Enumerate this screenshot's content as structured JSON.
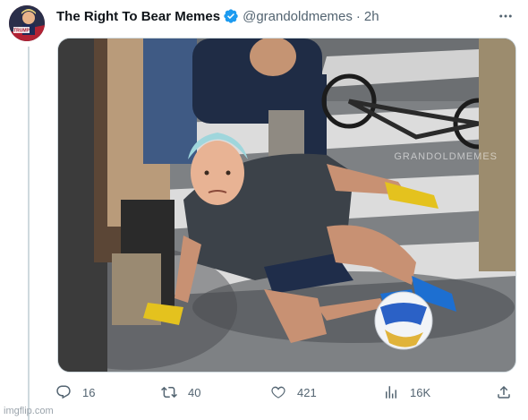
{
  "tweet": {
    "author": {
      "display_name": "The Right To Bear Memes",
      "verified": true,
      "handle": "@grandoldmemes",
      "separator": "·",
      "time": "2h",
      "avatar_text": "TRUMP"
    },
    "media": {
      "watermark": "GRANDOLDMEMES"
    },
    "actions": {
      "reply": {
        "icon": "reply-icon",
        "count": "16"
      },
      "retweet": {
        "icon": "retweet-icon",
        "count": "40"
      },
      "like": {
        "icon": "heart-icon",
        "count": "421"
      },
      "views": {
        "icon": "views-icon",
        "count": "16K"
      },
      "share": {
        "icon": "share-icon"
      }
    }
  },
  "footer": {
    "watermark": "imgflip.com"
  },
  "colors": {
    "text_primary": "#0f1419",
    "text_secondary": "#536471",
    "verified_blue": "#1d9bf0",
    "thread_line": "#cfd9de"
  }
}
